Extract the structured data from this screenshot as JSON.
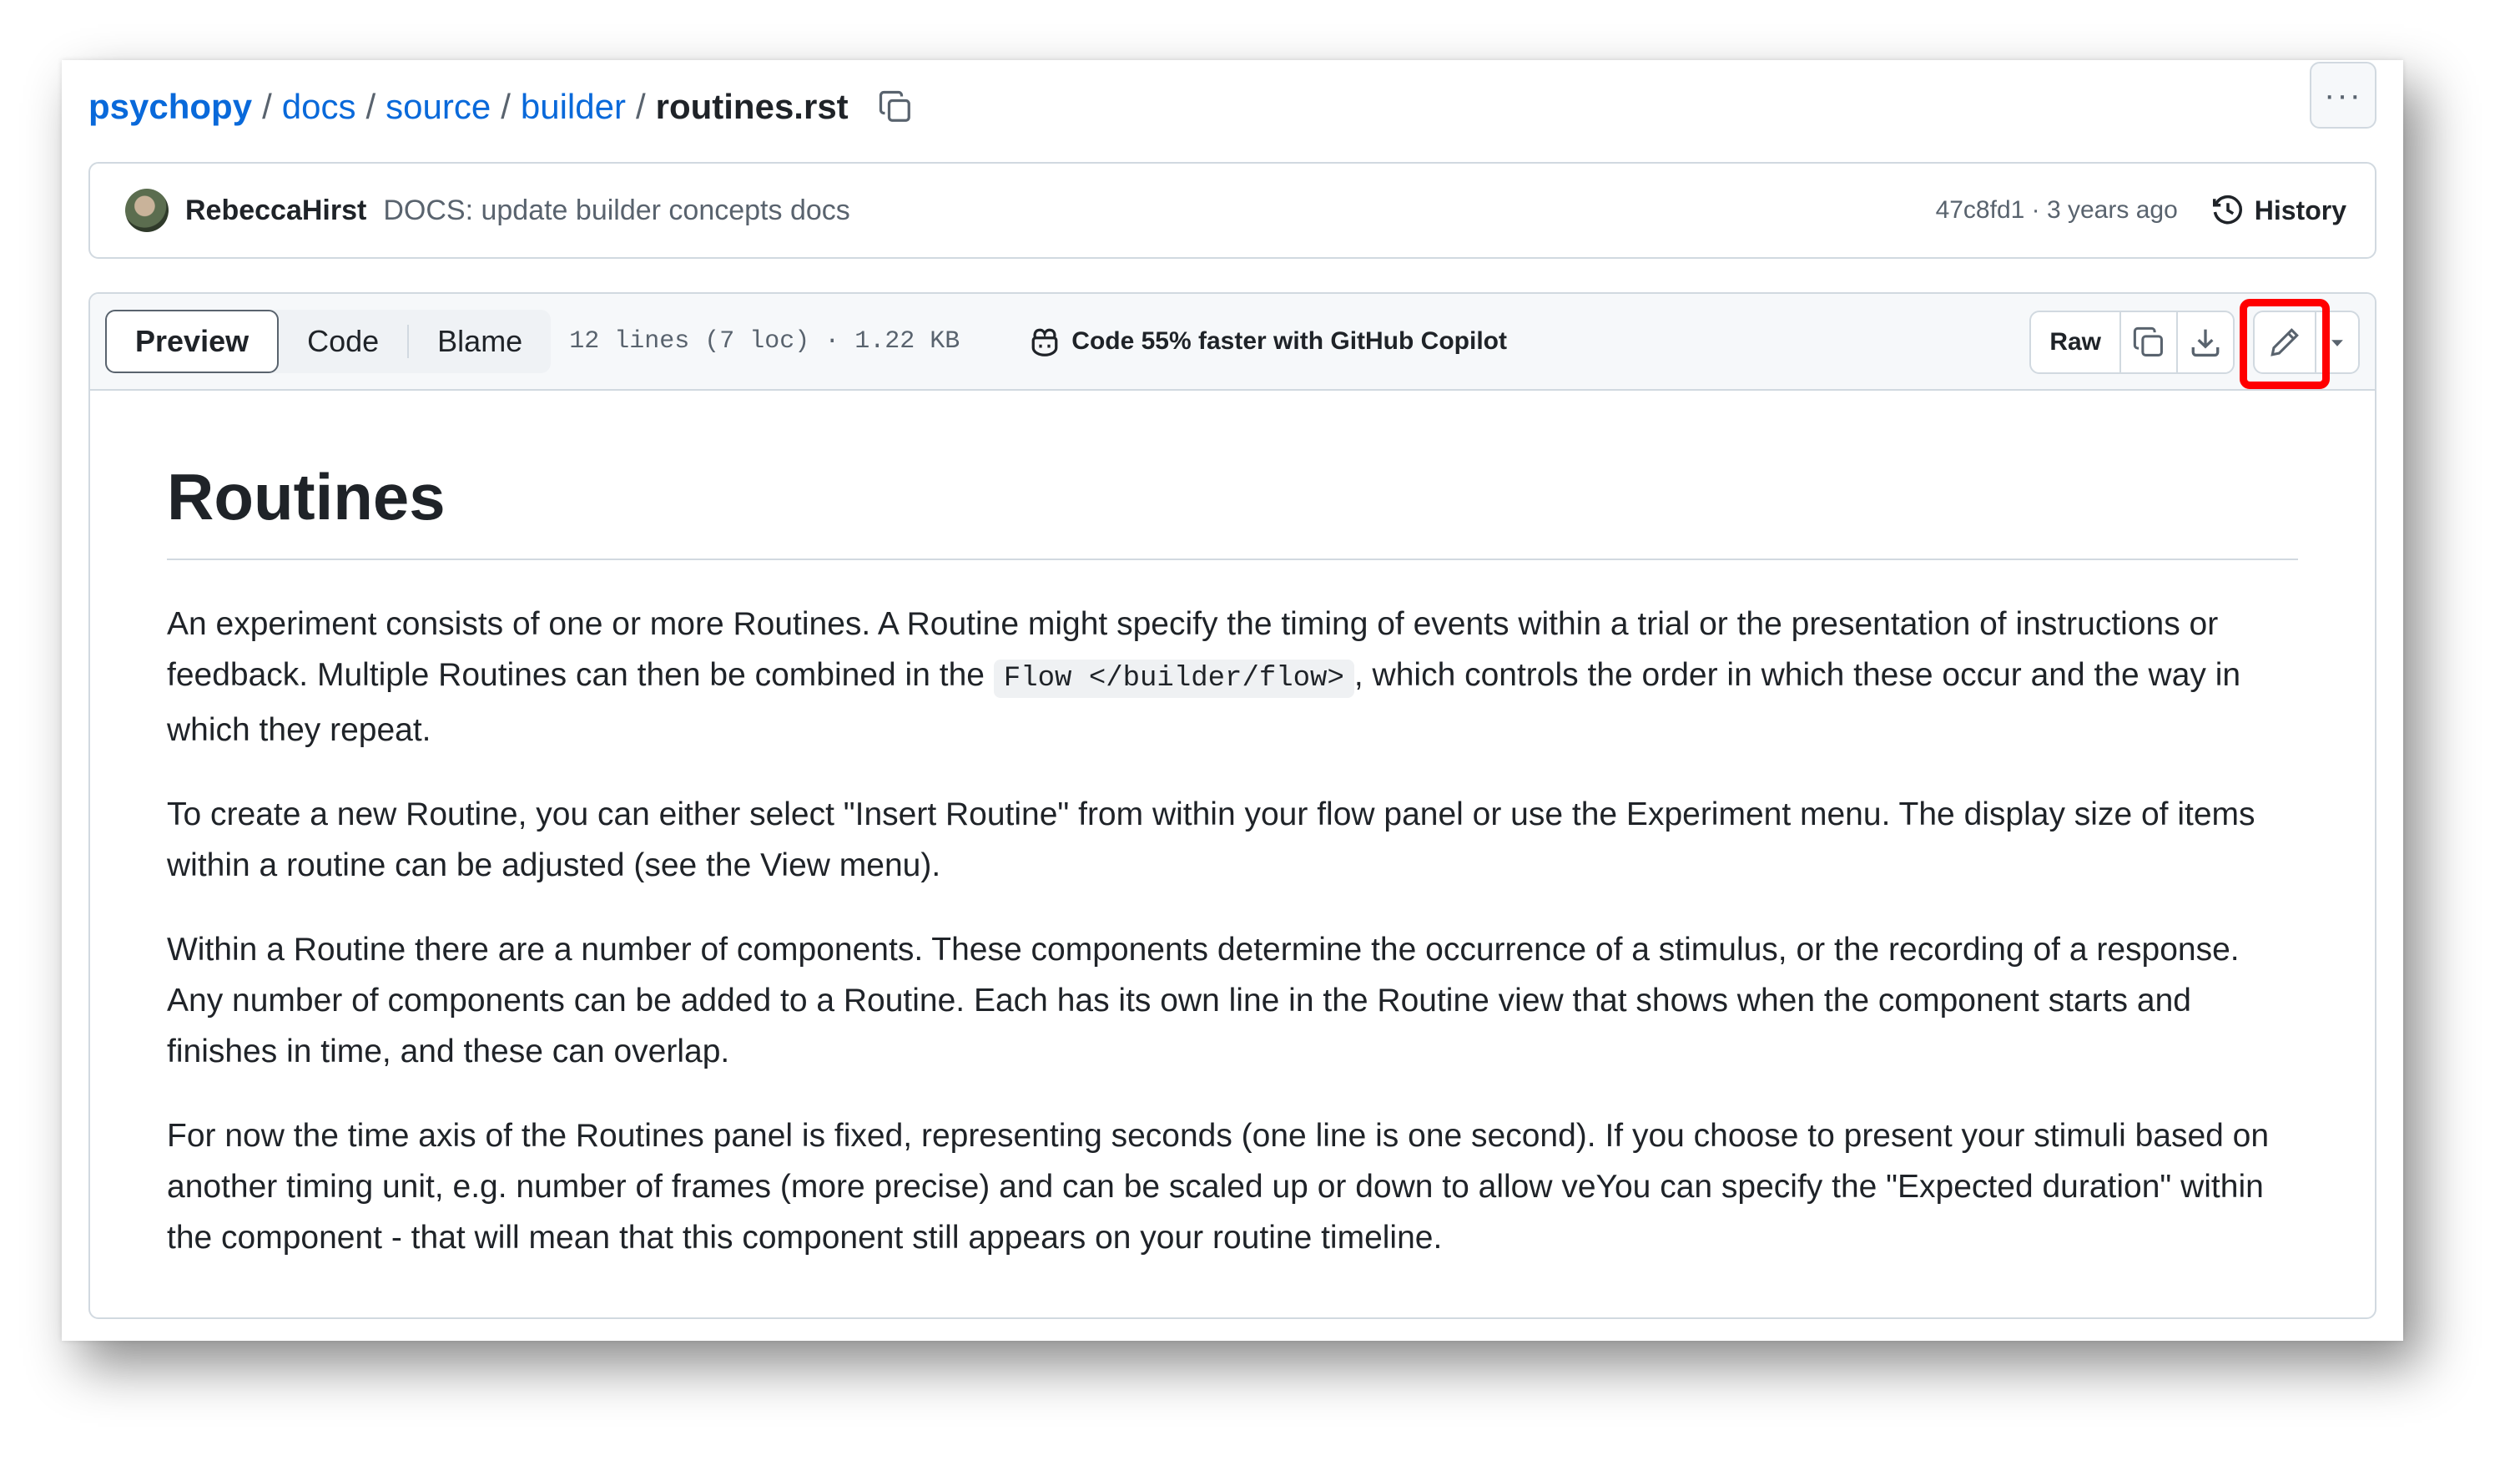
{
  "breadcrumb": {
    "items": [
      "psychopy",
      "docs",
      "source",
      "builder"
    ],
    "current": "routines.rst",
    "separator": "/"
  },
  "header": {
    "more_label": "···"
  },
  "commit": {
    "author": "RebeccaHirst",
    "message": "DOCS: update builder concepts docs",
    "meta": "47c8fd1 · 3 years ago",
    "history_label": "History"
  },
  "file": {
    "tabs": [
      {
        "label": "Preview",
        "active": true
      },
      {
        "label": "Code",
        "active": false
      },
      {
        "label": "Blame",
        "active": false
      }
    ],
    "stats": "12 lines (7 loc) · 1.22 KB",
    "copilot_label": "Code 55% faster with GitHub Copilot",
    "raw_label": "Raw"
  },
  "content": {
    "title": "Routines",
    "p1_before": "An experiment consists of one or more Routines. A Routine might specify the timing of events within a trial or the presentation of instructions or feedback. Multiple Routines can then be combined in the ",
    "p1_code": "Flow </builder/flow>",
    "p1_after": ", which controls the order in which these occur and the way in which they repeat.",
    "p2": "To create a new Routine, you can either select \"Insert Routine\" from within your flow panel or use the Experiment menu. The display size of items within a routine can be adjusted (see the View menu).",
    "p3": "Within a Routine there are a number of components. These components determine the occurrence of a stimulus, or the recording of a response. Any number of components can be added to a Routine. Each has its own line in the Routine view that shows when the component starts and finishes in time, and these can overlap.",
    "p4": "For now the time axis of the Routines panel is fixed, representing seconds (one line is one second). If you choose to present your stimuli based on another timing unit, e.g. number of frames (more precise) and can be scaled up or down to allow veYou can specify the \"Expected duration\" within the component - that will mean that this component still appears on your routine timeline."
  },
  "colors": {
    "link": "#0969da",
    "highlight": "#ff0000",
    "border": "#d1d9e0"
  }
}
